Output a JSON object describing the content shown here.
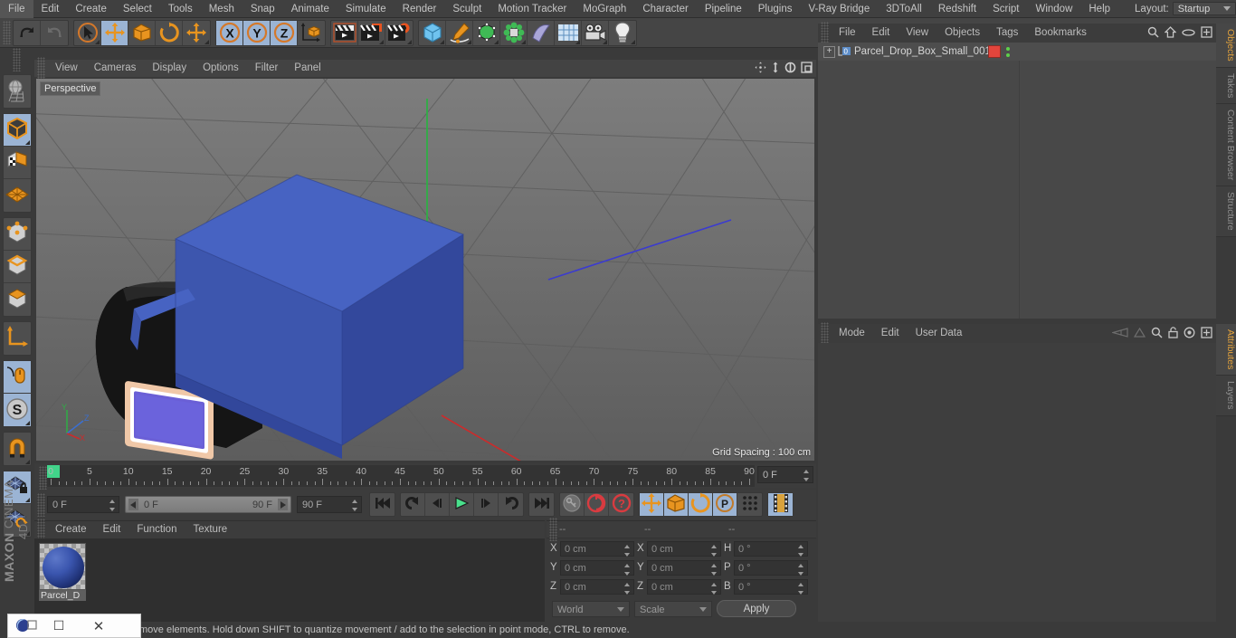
{
  "app": {
    "name": "MAXON CINEMA 4D",
    "brand_line1": "MAXON",
    "brand_line2": "CINEMA 4D"
  },
  "menubar": {
    "items": [
      "File",
      "Edit",
      "Create",
      "Select",
      "Tools",
      "Mesh",
      "Snap",
      "Animate",
      "Simulate",
      "Render",
      "Sculpt",
      "Motion Tracker",
      "MoGraph",
      "Character",
      "Pipeline",
      "Plugins",
      "V-Ray Bridge",
      "3DToAll",
      "Redshift",
      "Script",
      "Window",
      "Help"
    ],
    "layout_label": "Layout:",
    "layout_value": "Startup"
  },
  "toolbar": {
    "groups": [
      {
        "buttons": [
          {
            "name": "undo-button",
            "icon": "undo-icon",
            "active": false,
            "corner": false
          },
          {
            "name": "redo-button",
            "icon": "redo-icon",
            "active": false,
            "corner": false
          }
        ]
      },
      {
        "buttons": [
          {
            "name": "live-selection-tool",
            "icon": "cursor-circle-icon",
            "active": false,
            "corner": true
          },
          {
            "name": "move-tool",
            "icon": "move-arrows-icon",
            "active": true,
            "corner": false
          },
          {
            "name": "scale-tool",
            "icon": "scale-box-icon",
            "active": false,
            "corner": false
          },
          {
            "name": "rotate-tool",
            "icon": "rotate-icon",
            "active": false,
            "corner": false
          },
          {
            "name": "dynamic-place-tool",
            "icon": "move-arrows-icon",
            "active": false,
            "corner": true
          }
        ]
      },
      {
        "buttons": [
          {
            "name": "axis-x-lock",
            "icon": "x-axis-icon",
            "active": true,
            "corner": false
          },
          {
            "name": "axis-y-lock",
            "icon": "y-axis-icon",
            "active": true,
            "corner": false
          },
          {
            "name": "axis-z-lock",
            "icon": "z-axis-icon",
            "active": true,
            "corner": false
          },
          {
            "name": "world-object-coord-toggle",
            "icon": "world-axis-cube-icon",
            "active": false,
            "corner": false
          }
        ]
      },
      {
        "buttons": [
          {
            "name": "render-view-button",
            "icon": "clapper-render-icon",
            "active": false,
            "corner": false
          },
          {
            "name": "render-to-picture-viewer-button",
            "icon": "clapper-picture-icon",
            "active": false,
            "corner": true
          },
          {
            "name": "render-settings-button",
            "icon": "clapper-gear-icon",
            "active": false,
            "corner": true
          }
        ]
      },
      {
        "buttons": [
          {
            "name": "primitive-cube-button",
            "icon": "blue-cube-icon",
            "active": false,
            "corner": true
          },
          {
            "name": "spline-pen-button",
            "icon": "pen-spline-icon",
            "active": false,
            "corner": true
          },
          {
            "name": "generator-button",
            "icon": "green-cube-icon",
            "active": false,
            "corner": true
          },
          {
            "name": "deformer-button",
            "icon": "green-cluster-icon",
            "active": false,
            "corner": true
          },
          {
            "name": "scene-object-button",
            "icon": "curved-surface-icon",
            "active": false,
            "corner": false
          },
          {
            "name": "floor-environment-button",
            "icon": "grid-plane-icon",
            "active": false,
            "corner": true
          },
          {
            "name": "camera-button",
            "icon": "camera-icon",
            "active": false,
            "corner": true
          },
          {
            "name": "light-button",
            "icon": "lightbulb-icon",
            "active": false,
            "corner": true
          }
        ]
      }
    ]
  },
  "left_toolbar": {
    "groups": [
      {
        "buttons": [
          {
            "name": "make-editable-button",
            "icon": "globe-wire-icon",
            "active": false,
            "corner": false
          }
        ]
      },
      {
        "buttons": [
          {
            "name": "model-mode-button",
            "icon": "model-cube-icon",
            "active": true,
            "corner": true
          },
          {
            "name": "texture-mode-button",
            "icon": "texture-cube-icon",
            "active": false,
            "corner": false
          },
          {
            "name": "workplane-mode-button",
            "icon": "workplane-grid-icon",
            "active": false,
            "corner": false
          }
        ]
      },
      {
        "buttons": [
          {
            "name": "point-mode-button",
            "icon": "point-cube-icon",
            "active": false,
            "corner": false
          },
          {
            "name": "edge-mode-button",
            "icon": "edge-cube-icon",
            "active": false,
            "corner": false
          },
          {
            "name": "polygon-mode-button",
            "icon": "polygon-cube-icon",
            "active": false,
            "corner": false
          }
        ]
      },
      {
        "buttons": [
          {
            "name": "object-axis-mode-button",
            "icon": "axis-l-icon",
            "active": false,
            "corner": false
          }
        ]
      },
      {
        "buttons": [
          {
            "name": "enable-axis-modification-button",
            "icon": "mouse-axis-icon",
            "active": true,
            "corner": false
          },
          {
            "name": "soft-selection-button",
            "icon": "s-circle-icon",
            "active": true,
            "corner": true
          }
        ]
      },
      {
        "buttons": [
          {
            "name": "enable-snapping-button",
            "icon": "magnet-icon",
            "active": false,
            "corner": true
          }
        ]
      },
      {
        "buttons": [
          {
            "name": "lock-workplane-button",
            "icon": "grid-lock-icon",
            "active": true,
            "corner": true
          },
          {
            "name": "planar-workplane-button",
            "icon": "grid-rotate-icon",
            "active": false,
            "corner": true
          }
        ]
      }
    ]
  },
  "viewport": {
    "menu_items": [
      "View",
      "Cameras",
      "Display",
      "Options",
      "Filter",
      "Panel"
    ],
    "view_label": "Perspective",
    "grid_spacing": "Grid Spacing : 100 cm",
    "nav_icons": [
      "pan-icon",
      "zoom-icon",
      "rotate-icon",
      "maximize-viewport-icon"
    ],
    "axis_gizmo": {
      "y_label": "Y",
      "z_label": "Z",
      "x_label": "X"
    }
  },
  "timeline": {
    "tick_labels": [
      "0",
      "5",
      "10",
      "15",
      "20",
      "25",
      "30",
      "35",
      "40",
      "45",
      "50",
      "55",
      "60",
      "65",
      "70",
      "75",
      "80",
      "85",
      "90"
    ],
    "range_start": 0,
    "range_end": 90,
    "current_frame_field": "0 F"
  },
  "transport": {
    "current_frame": "0 F",
    "range_start": "0 F",
    "range_end": "90 F",
    "end_frame": "90 F",
    "buttons": [
      {
        "name": "go-to-start-button",
        "icon": "skip-start-icon"
      },
      {
        "name": "play-backwards-button",
        "icon": "rewind-loop-icon"
      },
      {
        "name": "previous-frame-button",
        "icon": "step-back-icon"
      },
      {
        "name": "play-button",
        "icon": "play-icon"
      },
      {
        "name": "next-frame-button",
        "icon": "step-forward-icon"
      },
      {
        "name": "play-forwards-button",
        "icon": "forward-loop-icon"
      },
      {
        "name": "go-to-end-button",
        "icon": "skip-end-icon"
      },
      {
        "name": "record-active-objects-button",
        "icon": "key-icon"
      },
      {
        "name": "autokeying-button",
        "icon": "red-circle-icon"
      },
      {
        "name": "keyframe-selection-button",
        "icon": "red-question-icon"
      },
      {
        "name": "position-key-button",
        "icon": "move-arrows-icon"
      },
      {
        "name": "scale-key-button",
        "icon": "scale-box-icon"
      },
      {
        "name": "rotation-key-button",
        "icon": "rotate-icon"
      },
      {
        "name": "param-key-button",
        "icon": "p-circle-icon"
      },
      {
        "name": "point-level-animation-button",
        "icon": "dots-grid-icon"
      },
      {
        "name": "timeline-toggle-button",
        "icon": "filmstrip-icon"
      }
    ]
  },
  "material_manager": {
    "menu_items": [
      "Create",
      "Edit",
      "Function",
      "Texture"
    ],
    "materials": [
      {
        "name": "Parcel_D",
        "color": "#3a55ae"
      }
    ]
  },
  "coordinates": {
    "headers": [
      "--",
      "--",
      "--"
    ],
    "rows": [
      {
        "pos_label": "X",
        "pos_value": "0 cm",
        "size_label": "X",
        "size_value": "0 cm",
        "rot_label": "H",
        "rot_value": "0 °"
      },
      {
        "pos_label": "Y",
        "pos_value": "0 cm",
        "size_label": "Y",
        "size_value": "0 cm",
        "rot_label": "P",
        "rot_value": "0 °"
      },
      {
        "pos_label": "Z",
        "pos_value": "0 cm",
        "size_label": "Z",
        "size_value": "0 cm",
        "rot_label": "B",
        "rot_value": "0 °"
      }
    ],
    "system_select": "World",
    "mode_select": "Scale",
    "apply_label": "Apply"
  },
  "object_manager": {
    "menu_items": [
      "File",
      "Edit",
      "View",
      "Objects",
      "Tags",
      "Bookmarks"
    ],
    "tool_icons": [
      "search-icon",
      "home-icon",
      "ellipse-icon",
      "plus-box-icon"
    ],
    "objects": [
      {
        "name": "Parcel_Drop_Box_Small_001",
        "level_badge": "0",
        "tag_color": "#e2453c"
      }
    ]
  },
  "attribute_manager": {
    "menu_items": [
      "Mode",
      "Edit",
      "User Data"
    ],
    "tool_icons": [
      "history-back-icon",
      "history-forward-icon",
      "search-icon",
      "lock-icon",
      "target-icon",
      "plus-box-icon"
    ]
  },
  "right_tabs": {
    "top": [
      {
        "label": "Objects",
        "active": true
      },
      {
        "label": "Takes",
        "active": false
      },
      {
        "label": "Content Browser",
        "active": false
      },
      {
        "label": "Structure",
        "active": false
      }
    ],
    "bottom": [
      {
        "label": "Attributes",
        "active": true
      },
      {
        "label": "Layers",
        "active": false
      }
    ]
  },
  "statusbar": {
    "message": "move elements. Hold down SHIFT to quantize movement / add to the selection in point mode, CTRL to remove."
  },
  "taskbar_overlay": {
    "icon": "c4d-app-icon",
    "minimize_label": "☐",
    "close_label": "✕"
  },
  "colors": {
    "accent_orange": "#e3a23c",
    "select_blue": "#9bb4d4",
    "model_blue": "#3f5bb5",
    "tag_red": "#e2453c",
    "green": "#41d48a"
  }
}
